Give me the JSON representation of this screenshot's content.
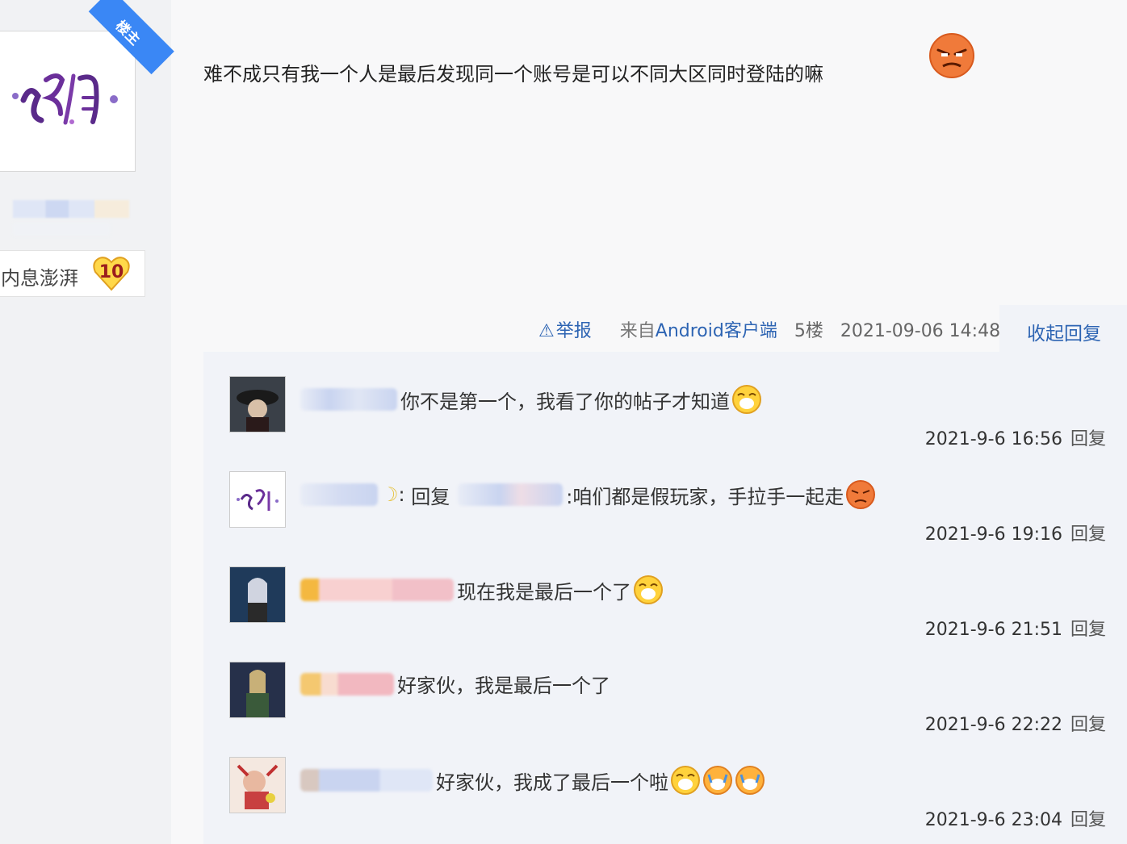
{
  "sidebar": {
    "lz_badge": "楼主",
    "level_label": "内息澎湃",
    "level_value": "10"
  },
  "post": {
    "text": "难不成只有我一个人是最后发现同一个账号是可以不同大区同时登陆的嘛"
  },
  "meta": {
    "report": "举报",
    "source_prefix": "来自",
    "source_client": "Android客户端",
    "floor": "5楼",
    "datetime": "2021-09-06 14:48",
    "collapse": "收起回复"
  },
  "replies": [
    {
      "text": "你不是第一个，我看了你的帖子才知道",
      "time": "2021-9-6 16:56",
      "reply_label": "回复"
    },
    {
      "reply_word": "回复",
      "text": ":咱们都是假玩家，手拉手一起走",
      "time": "2021-9-6 19:16",
      "reply_label": "回复"
    },
    {
      "text": "现在我是最后一个了",
      "time": "2021-9-6 21:51",
      "reply_label": "回复"
    },
    {
      "text": "好家伙，我是最后一个了",
      "time": "2021-9-6 22:22",
      "reply_label": "回复"
    },
    {
      "text": "好家伙，我成了最后一个啦",
      "time": "2021-9-6 23:04",
      "reply_label": "回复"
    }
  ],
  "colors": {
    "link": "#2d64b3",
    "ribbon": "#3a87f5",
    "reply_bg": "#f1f3f8"
  }
}
